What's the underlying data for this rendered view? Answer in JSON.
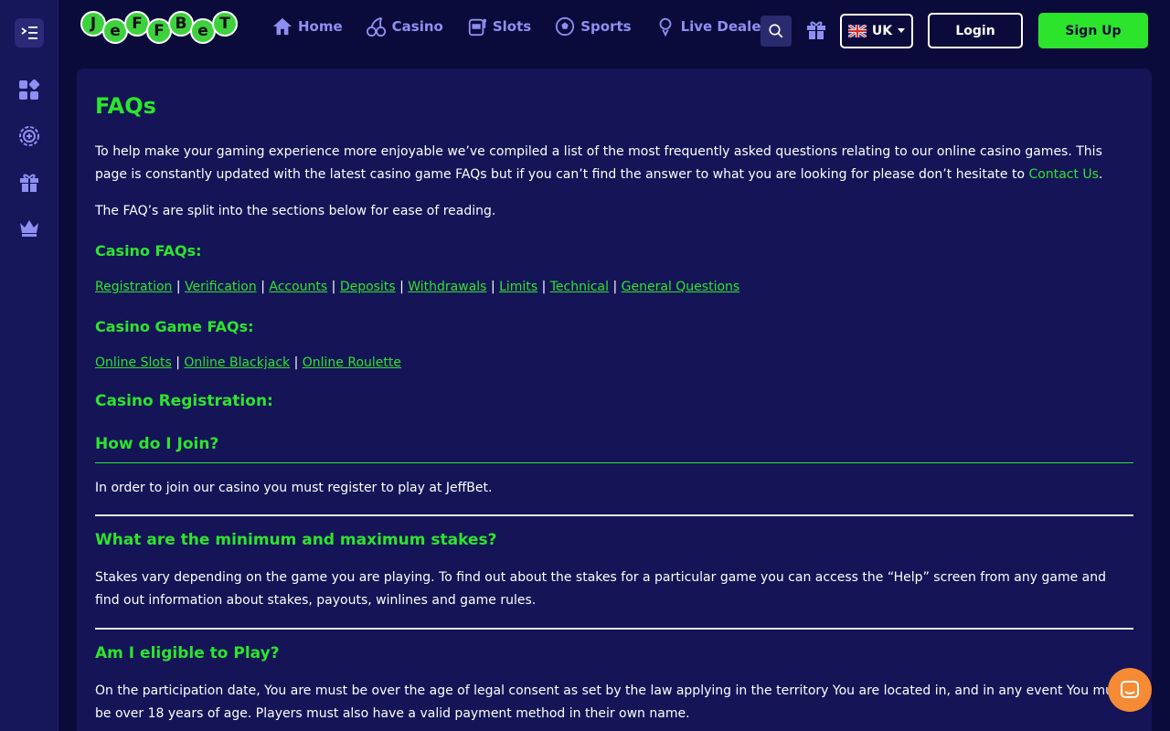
{
  "brand": {
    "logo_letters": [
      "J",
      "e",
      "F",
      "F",
      "B",
      "e",
      "T"
    ],
    "accent": "#2de42d",
    "background": "#0b0b3b",
    "panel": "#141457",
    "nav_color": "#8f8ff2"
  },
  "sidebar": {
    "items": [
      {
        "icon": "menu-toggle-icon"
      },
      {
        "icon": "games-grid-icon"
      },
      {
        "icon": "casino-chip-icon"
      },
      {
        "icon": "gift-icon"
      },
      {
        "icon": "crown-icon"
      }
    ]
  },
  "nav": {
    "home": "Home",
    "casino": "Casino",
    "slots": "Slots",
    "sports": "Sports",
    "live_dealer": "Live Dealer"
  },
  "header": {
    "language": "UK",
    "login": "Login",
    "signup": "Sign Up"
  },
  "content": {
    "title": "FAQs",
    "intro_1": "To help make your gaming experience more enjoyable we’ve compiled a list of the most frequently asked questions relating to our online casino games. This page is constantly updated with the latest casino game FAQs but if you can’t find the answer to what you are looking for please don’t hesitate to ",
    "intro_link": "Contact Us",
    "intro_end": ".",
    "intro_2": "The FAQ’s are split into the sections below for ease of reading.",
    "casino_faqs_title": "Casino FAQs:",
    "casino_links": [
      "Registration",
      "Verification",
      "Accounts",
      "Deposits",
      "Withdrawals",
      "Limits",
      "Technical",
      "General Questions"
    ],
    "game_faqs_title": "Casino Game FAQs:",
    "game_links": [
      "Online Slots",
      "Online Blackjack",
      "Online Roulette"
    ],
    "separator": "|",
    "registration_title": "Casino Registration:",
    "q1": "How do I Join?",
    "a1": "In order to join our casino you must register to play at JeffBet.",
    "q2": "What are the minimum and maximum stakes?",
    "a2": "Stakes vary depending on the game you are playing. To find out about the stakes for a particular game you can access the “Help” screen from any game and find out information about stakes, payouts, winlines and game rules.",
    "q3": "Am I eligible to Play?",
    "a3": "On the participation date, You are must be over the age of legal consent as set by the law applying in the territory You are located in, and in any event You must be over 18 years of age. Players must also have a valid payment method in their own name."
  }
}
